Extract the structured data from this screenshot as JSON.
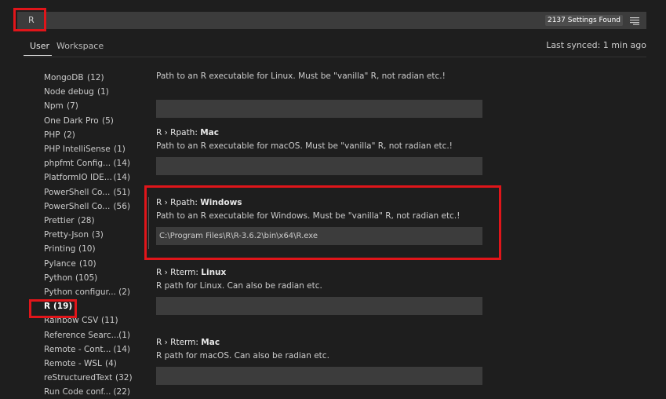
{
  "search": {
    "value": "R",
    "results_count": "2137 Settings Found",
    "filter_icon": "filter-icon"
  },
  "tabs": {
    "user": "User",
    "workspace": "Workspace"
  },
  "last_synced": "Last synced: 1 min ago",
  "toc": {
    "items": [
      {
        "name": "MongoDB",
        "count": "(12)"
      },
      {
        "name": "Node debug",
        "count": "(1)"
      },
      {
        "name": "Npm",
        "count": "(7)"
      },
      {
        "name": "One Dark Pro",
        "count": "(5)"
      },
      {
        "name": "PHP",
        "count": "(2)"
      },
      {
        "name": "PHP IntelliSense",
        "count": "(1)"
      },
      {
        "name": "phpfmt Config...",
        "count": "(14)"
      },
      {
        "name": "PlatformIO IDE...",
        "count": "(14)"
      },
      {
        "name": "PowerShell Co...",
        "count": "(51)"
      },
      {
        "name": "PowerShell Co...",
        "count": "(56)"
      },
      {
        "name": "Prettier",
        "count": "(28)"
      },
      {
        "name": "Pretty-Json",
        "count": "(3)"
      },
      {
        "name": "Printing",
        "count": "(10)"
      },
      {
        "name": "Pylance",
        "count": "(10)"
      },
      {
        "name": "Python",
        "count": "(105)"
      },
      {
        "name": "Python configur...",
        "count": "(2)"
      },
      {
        "name": "R",
        "count": "(19)"
      },
      {
        "name": "Rainbow CSV",
        "count": "(11)"
      },
      {
        "name": "Reference Searc...",
        "count": "(1)"
      },
      {
        "name": "Remote - Cont...",
        "count": "(14)"
      },
      {
        "name": "Remote - WSL",
        "count": "(4)"
      },
      {
        "name": "reStructuredText",
        "count": "(32)"
      },
      {
        "name": "Run Code conf...",
        "count": "(22)"
      }
    ]
  },
  "settings": [
    {
      "category": "",
      "key": "",
      "description": "Path to an R executable for Linux. Must be \"vanilla\" R, not radian etc.!",
      "value": ""
    },
    {
      "category": "R › Rpath: ",
      "key": "Mac",
      "description": "Path to an R executable for macOS. Must be \"vanilla\" R, not radian etc.!",
      "value": ""
    },
    {
      "category": "R › Rpath: ",
      "key": "Windows",
      "description": "Path to an R executable for Windows. Must be \"vanilla\" R, not radian etc.!",
      "value": "C:\\Program Files\\R\\R-3.6.2\\bin\\x64\\R.exe"
    },
    {
      "category": "R › Rterm: ",
      "key": "Linux",
      "description": "R path for Linux. Can also be radian etc.",
      "value": ""
    },
    {
      "category": "R › Rterm: ",
      "key": "Mac",
      "description": "R path for macOS. Can also be radian etc.",
      "value": ""
    }
  ],
  "colors": {
    "background": "#1e1e1e",
    "input_background": "#3c3c3c",
    "highlight": "#e0151a"
  }
}
